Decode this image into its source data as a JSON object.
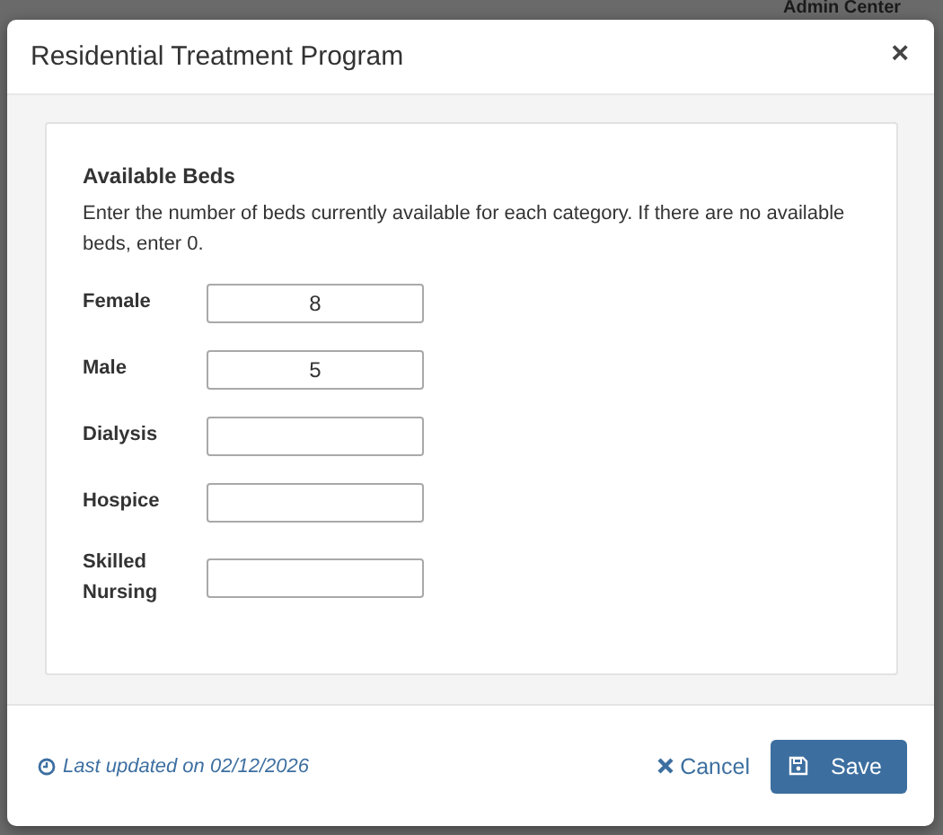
{
  "background": {
    "label": "Admin Center"
  },
  "dialog": {
    "title": "Residential Treatment Program",
    "close": "×"
  },
  "section": {
    "title": "Available Beds",
    "description": "Enter the number of beds currently available for each category. If there are no available beds, enter 0."
  },
  "fields": [
    {
      "label": "Female",
      "value": "8"
    },
    {
      "label": "Male",
      "value": "5"
    },
    {
      "label": "Dialysis"
    },
    {
      "label": "Hospice"
    },
    {
      "label": "Skilled Nursing"
    }
  ],
  "footer": {
    "last_updated": "Last updated on 02/12/2026",
    "cancel": "Cancel",
    "save": "Save"
  }
}
